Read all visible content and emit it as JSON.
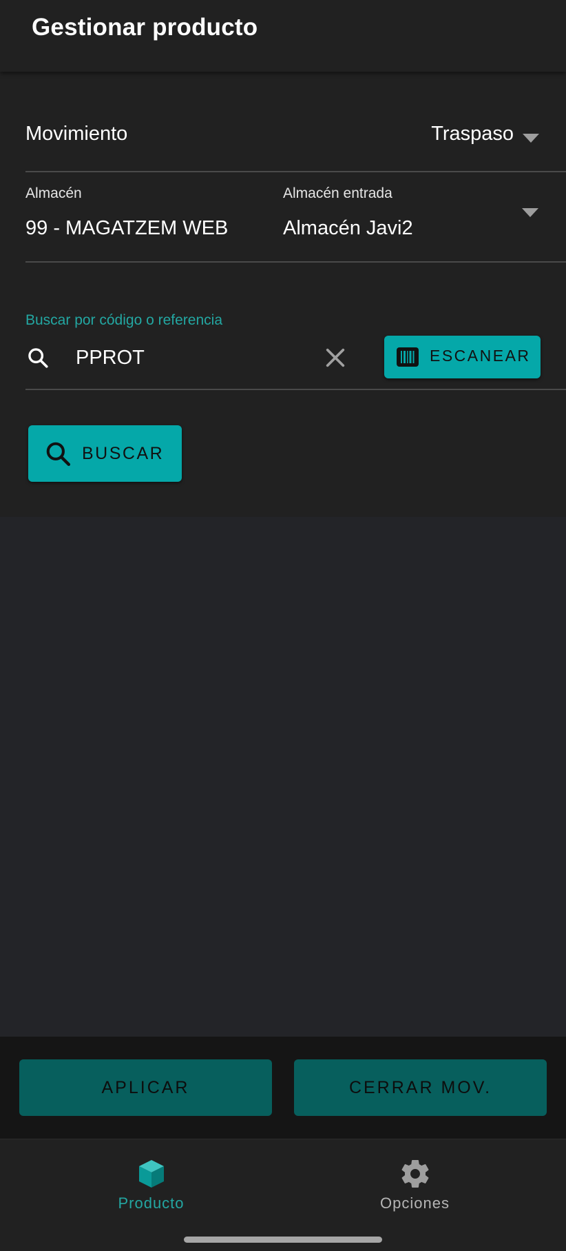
{
  "appbar": {
    "title": "Gestionar producto"
  },
  "movement": {
    "label": "Movimiento",
    "value": "Traspaso"
  },
  "warehouse": {
    "label": "Almacén",
    "value": "99 - MAGATZEM WEB",
    "entry_label": "Almacén entrada",
    "entry_value": "Almacén Javi2"
  },
  "search": {
    "label": "Buscar por código o referencia",
    "value": "PPROT",
    "scan_label": "ESCANEAR",
    "search_label": "BUSCAR"
  },
  "actions": {
    "apply_label": "APLICAR",
    "close_label": "CERRAR MOV."
  },
  "bottom_nav": {
    "items": [
      {
        "label": "Producto",
        "icon": "cube-icon",
        "active": true
      },
      {
        "label": "Opciones",
        "icon": "gear-icon",
        "active": false
      }
    ]
  },
  "colors": {
    "accent": "#05a8a9",
    "accent_dark": "#075f5d",
    "accent_text": "#23a7a2",
    "background": "#232428",
    "surface": "#212121"
  }
}
